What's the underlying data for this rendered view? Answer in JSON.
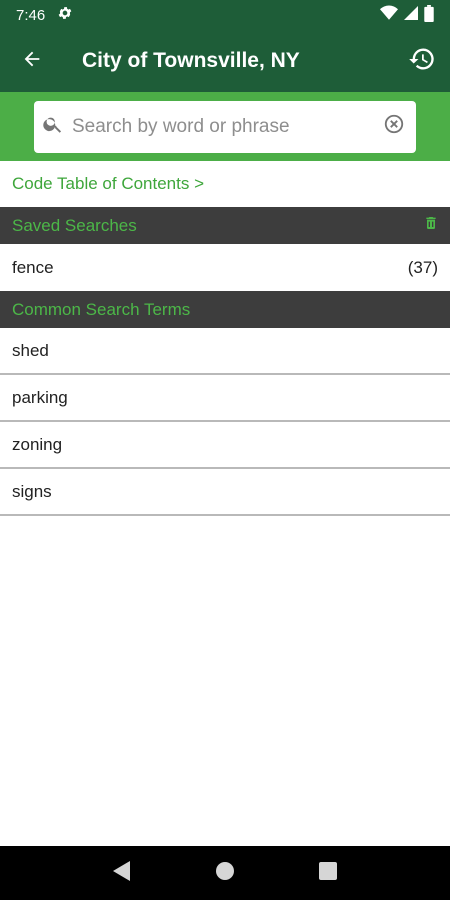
{
  "status": {
    "time": "7:46"
  },
  "app_bar": {
    "title": "City of Townsville, NY",
    "back_icon": "arrow-left-icon",
    "history_icon": "history-icon"
  },
  "search": {
    "placeholder": "Search by word or phrase",
    "value": ""
  },
  "toc": {
    "label": "Code Table of Contents >"
  },
  "saved_searches": {
    "header": "Saved Searches",
    "items": [
      {
        "term": "fence",
        "count": "(37)"
      }
    ]
  },
  "common_terms": {
    "header": "Common Search Terms",
    "items": [
      {
        "term": "shed"
      },
      {
        "term": "parking"
      },
      {
        "term": "zoning"
      },
      {
        "term": "signs"
      }
    ]
  },
  "colors": {
    "app_bar": "#1e5d38",
    "search_band": "#4cae47",
    "accent_text": "#3ea63b",
    "section_bg": "#3d3d3d"
  }
}
